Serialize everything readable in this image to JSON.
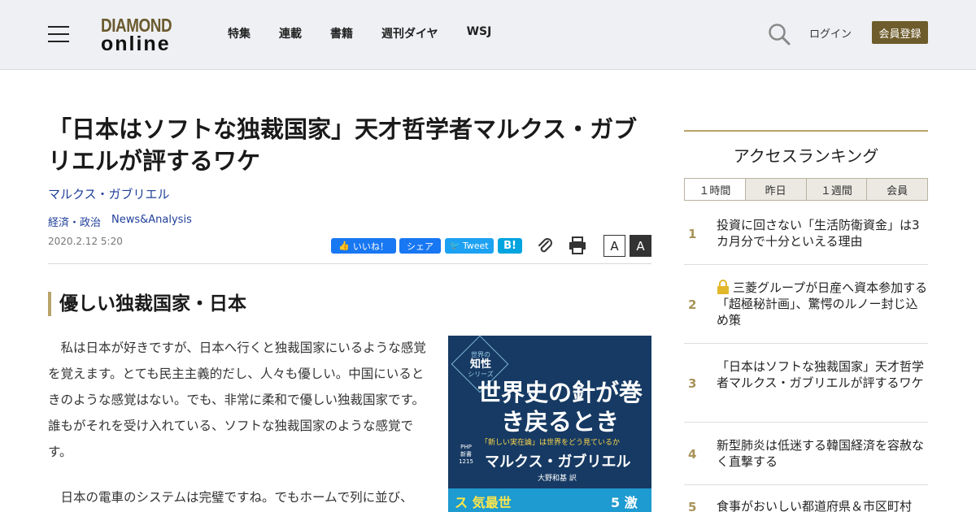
{
  "header": {
    "logo_top": "DIAMOND",
    "logo_bottom": "online",
    "nav": [
      "特集",
      "連載",
      "書籍",
      "週刊ダイヤ",
      "WSJ"
    ],
    "login": "ログイン",
    "register": "会員登録"
  },
  "article": {
    "title": "「日本はソフトな独裁国家」天才哲学者マルクス・ガブリエルが評するワケ",
    "author": "マルクス・ガブリエル",
    "tags": [
      "経済・政治",
      "News&Analysis"
    ],
    "date": "2020.2.12 5:20",
    "share": {
      "like": "いいね！",
      "share": "シェア",
      "tweet": "Tweet",
      "hatena": "B!"
    },
    "font_small": "A",
    "font_large": "A",
    "subhead": "優しい独裁国家・日本",
    "para1": "私は日本が好きですが、日本へ行くと独裁国家にいるような感覚を覚えます。とても民主主義的だし、人々も優しい。中国にいるときのような感覚はない。でも、非常に柔和で優しい独裁国家です。誰もがそれを受け入れている、ソフトな独裁国家のような感覚です。",
    "para2": "日本の電車のシステムは完璧ですね。でもホームで列に並び、"
  },
  "book": {
    "series_small": "世界の",
    "series_big": "知性",
    "series_tail": "シリーズ",
    "title": "世界史の針が巻き戻るとき",
    "subtitle": "「新しい実在論」は世界をどう見ているか",
    "publisher": "PHP新書1215",
    "author": "マルクス・ガブリエル",
    "translator": "大野和基 訳",
    "band": "ス 気最世",
    "band_right": "5 激"
  },
  "ranking": {
    "title": "アクセスランキング",
    "tabs": [
      "１時間",
      "昨日",
      "１週間",
      "会員"
    ],
    "active_tab": "１時間",
    "items": [
      {
        "rank": "1",
        "text": "投資に回さない「生活防衛資金」は3カ月分で十分といえる理由"
      },
      {
        "rank": "2",
        "text": "三菱グループが日産へ資本参加する「超極秘計画」、驚愕のルノー封じ込め策"
      },
      {
        "rank": "3",
        "text": "「日本はソフトな独裁国家」天才哲学者マルクス・ガブリエルが評するワケ"
      },
      {
        "rank": "4",
        "text": "新型肺炎は低迷する韓国経済を容赦なく直撃する"
      },
      {
        "rank": "5",
        "text": "食事がおいしい都道府県＆市区町村"
      }
    ]
  },
  "colors": {
    "accent": "#6e5c2c",
    "link": "#1f3f99",
    "rank_gold": "#a8935a"
  }
}
